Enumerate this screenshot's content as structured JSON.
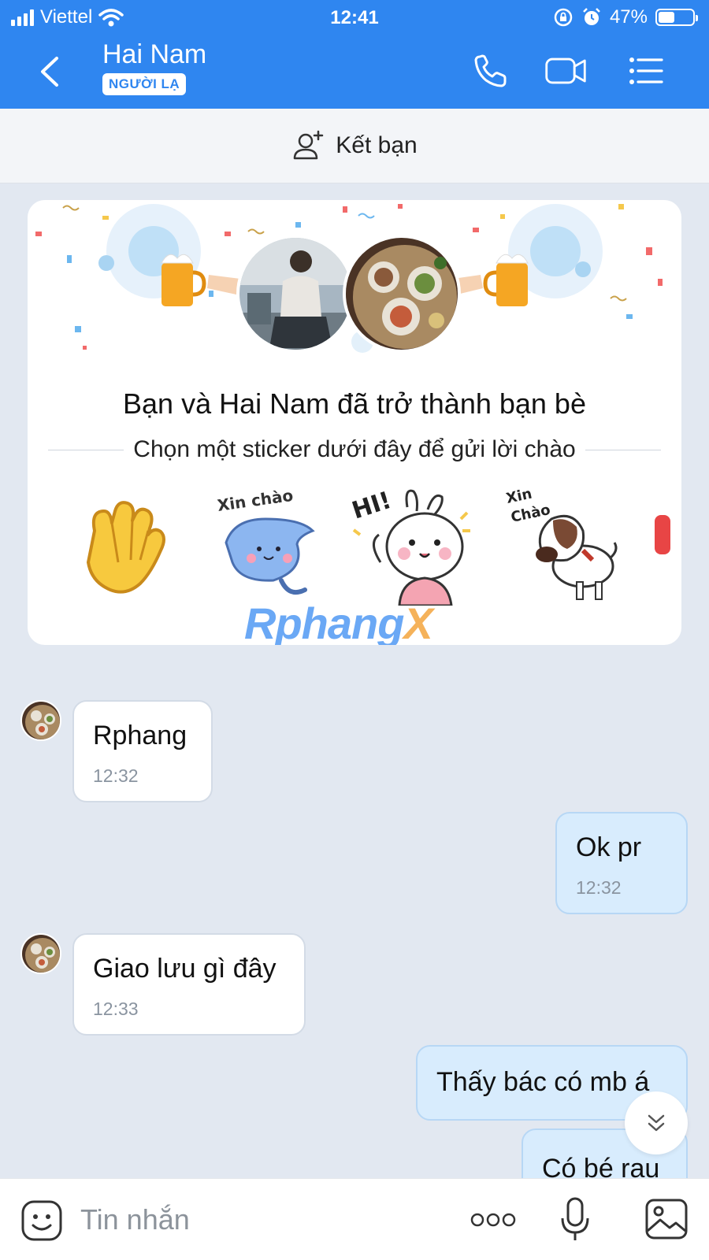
{
  "status_bar": {
    "carrier": "Viettel",
    "time": "12:41",
    "battery_percent": "47%",
    "battery_level": 0.47,
    "icons": [
      "signal-icon",
      "wifi-icon",
      "orientation-lock-icon",
      "alarm-icon",
      "battery-icon"
    ]
  },
  "header": {
    "title": "Hai Nam",
    "badge": "NGƯỜI LẠ",
    "icons": [
      "back-icon",
      "phone-icon",
      "video-camera-icon",
      "menu-icon"
    ],
    "color": "#2f86f0"
  },
  "add_friend": {
    "label": "Kết bạn",
    "icon": "add-user-icon"
  },
  "friend_card": {
    "title": "Bạn và Hai Nam đã trở thành bạn bè",
    "subtitle": "Chọn một sticker dưới đây để gửi lời chào",
    "stickers": [
      {
        "name": "waving-hand-sticker",
        "caption": ""
      },
      {
        "name": "xin-chao-cat-sticker",
        "caption": "Xin chào"
      },
      {
        "name": "hi-bunny-sticker",
        "caption": "HI!"
      },
      {
        "name": "xin-chao-dog-sticker",
        "caption": "Xin Chào"
      }
    ],
    "watermark": {
      "main": "Rphang",
      "accent": "X"
    }
  },
  "messages": [
    {
      "direction": "in",
      "text": "Rphang",
      "time": "12:32"
    },
    {
      "direction": "out",
      "text": "Ok pr",
      "time": "12:32"
    },
    {
      "direction": "in",
      "text": "Giao lưu gì đây",
      "time": "12:33"
    },
    {
      "direction": "out",
      "text": "Thấy bác có mb á",
      "time": ""
    },
    {
      "direction": "out",
      "text": "Có bé rau",
      "time": ""
    }
  ],
  "composer": {
    "placeholder": "Tin nhắn",
    "icons": [
      "sticker-smile-icon",
      "more-dots-icon",
      "microphone-icon",
      "image-icon"
    ]
  },
  "colors": {
    "accent": "#2f86f0",
    "chat_background": "#e2e8f1",
    "outgoing_bubble": "#d8ecfd",
    "incoming_bubble": "#ffffff"
  }
}
